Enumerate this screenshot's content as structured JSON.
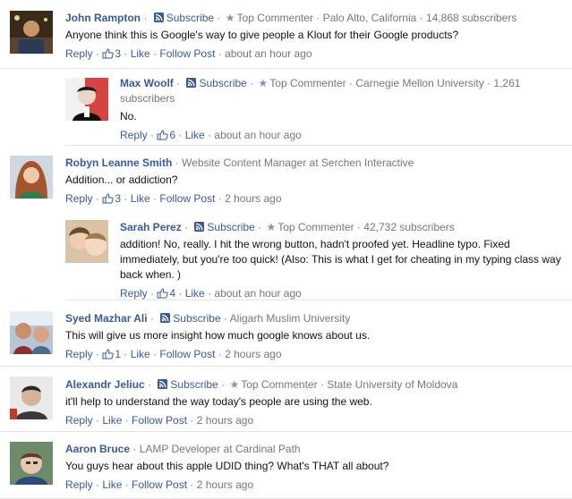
{
  "comments": [
    {
      "name": "John Rampton",
      "subscribe": "Subscribe",
      "badge": "Top Commenter",
      "meta": "Palo Alto, California · 14,868 subscribers",
      "text": "Anyone think this is Google's way to give people a Klout for their Google products?",
      "reply": "Reply",
      "likes": "3",
      "like": "Like",
      "follow": "Follow Post",
      "time": "about an hour ago"
    },
    {
      "name": "Max Woolf",
      "subscribe": "Subscribe",
      "badge": "Top Commenter",
      "meta": "Carnegie Mellon University · 1,261 subscribers",
      "text": "No.",
      "reply": "Reply",
      "likes": "6",
      "like": "Like",
      "time": "about an hour ago"
    },
    {
      "name": "Robyn Leanne Smith",
      "meta": "Website Content Manager at Serchen Interactive",
      "text": "Addition... or addiction?",
      "reply": "Reply",
      "likes": "3",
      "like": "Like",
      "follow": "Follow Post",
      "time": "2 hours ago"
    },
    {
      "name": "Sarah Perez",
      "subscribe": "Subscribe",
      "badge": "Top Commenter",
      "meta": "42,732 subscribers",
      "text": "addition! No, really. I hit the wrong button, hadn't proofed yet. Headline typo. Fixed immediately, but you're too quick! (Also: This is what I get for cheating in my typing class way back when. )",
      "reply": "Reply",
      "likes": "4",
      "like": "Like",
      "time": "about an hour ago"
    },
    {
      "name": "Syed Mazhar Ali",
      "subscribe": "Subscribe",
      "meta": "Aligarh Muslim University",
      "text": "This will give us more insight how much google knows about us.",
      "reply": "Reply",
      "likes": "1",
      "like": "Like",
      "follow": "Follow Post",
      "time": "2 hours ago"
    },
    {
      "name": "Alexandr Jeliuc",
      "subscribe": "Subscribe",
      "badge": "Top Commenter",
      "meta": "State University of Moldova",
      "text": "it'll help to understand the way today's people are using the web.",
      "reply": "Reply",
      "like": "Like",
      "follow": "Follow Post",
      "time": "2 hours ago"
    },
    {
      "name": "Aaron Bruce",
      "meta": "LAMP Developer at Cardinal Path",
      "text": "You guys hear about this apple UDID thing? What's THAT all about?",
      "reply": "Reply",
      "like": "Like",
      "follow": "Follow Post",
      "time": "2 hours ago"
    }
  ],
  "separator": " · ",
  "colors": {
    "link": "#3b5998",
    "meta": "#777777",
    "divider": "#e5e5e5"
  }
}
